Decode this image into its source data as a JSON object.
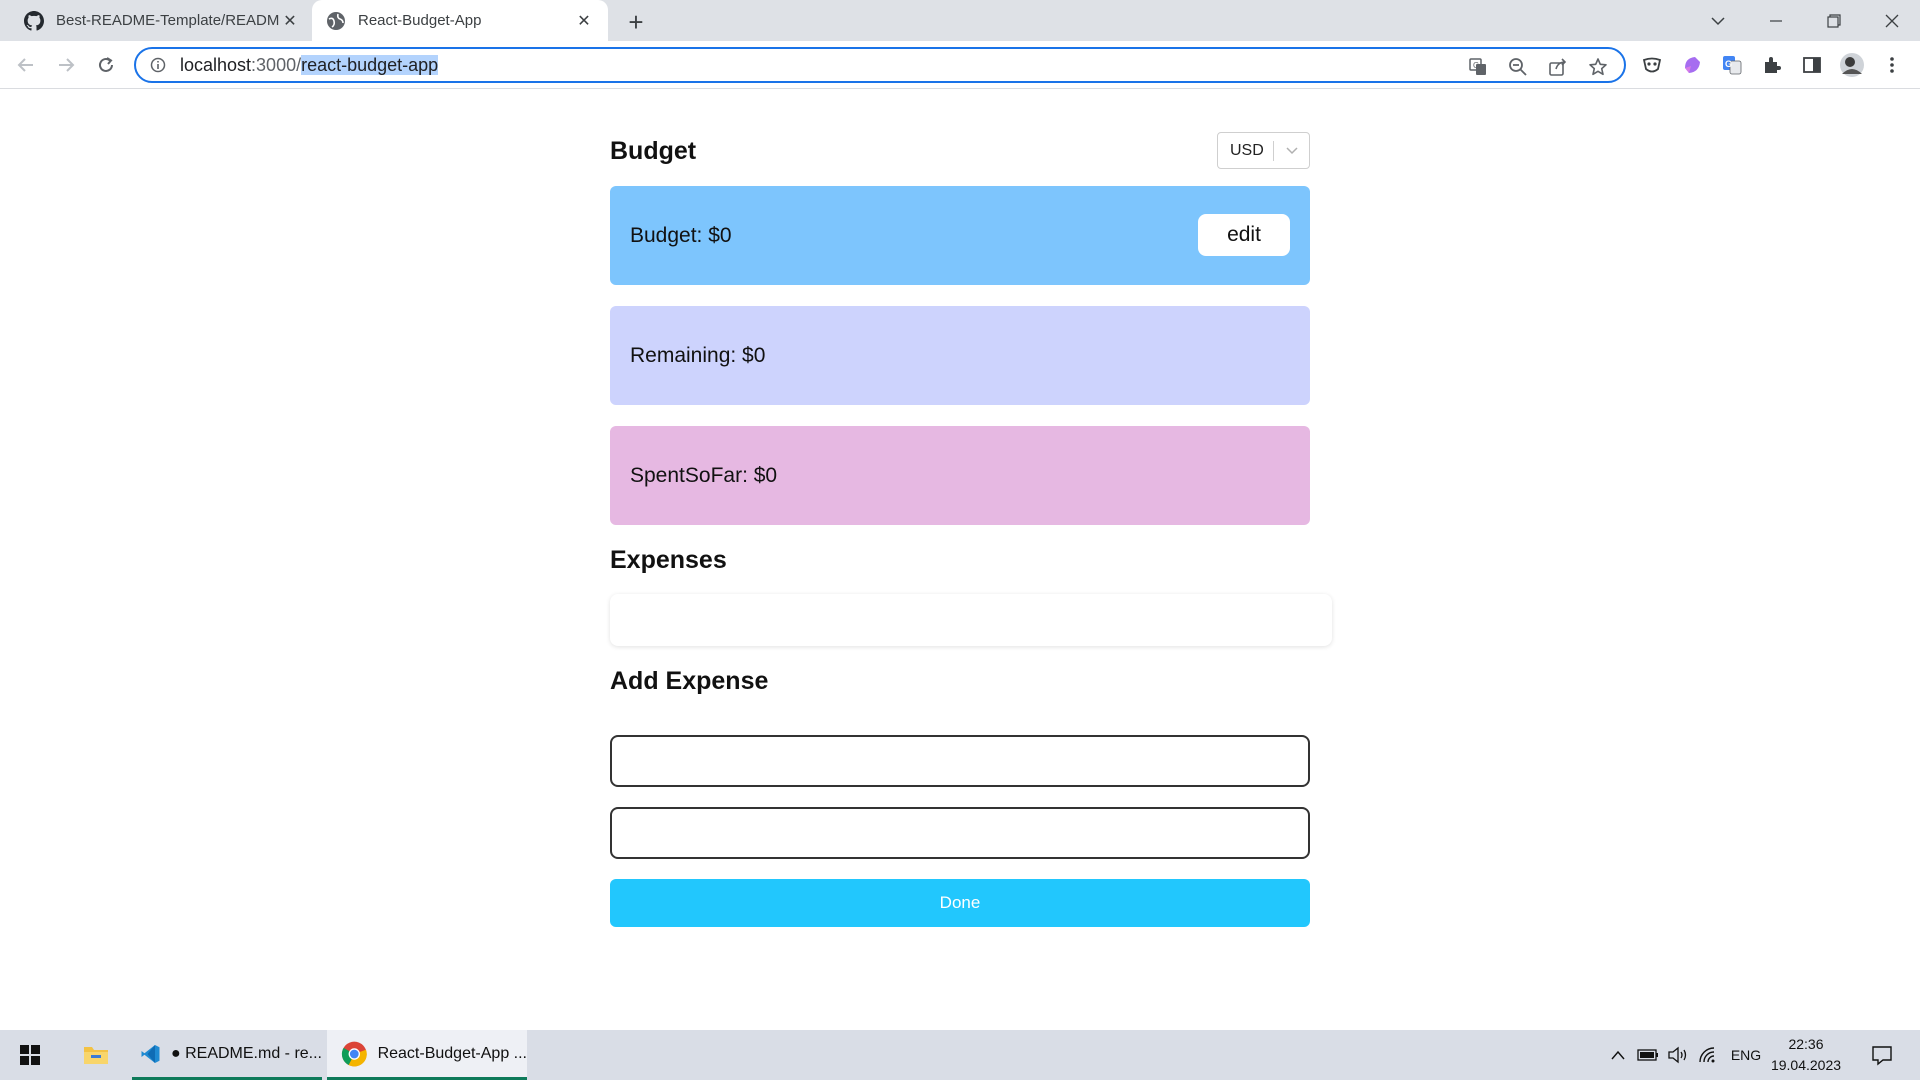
{
  "browser": {
    "tabs": [
      {
        "title": "Best-README-Template/READM",
        "icon": "github-icon",
        "active": false
      },
      {
        "title": "React-Budget-App",
        "icon": "globe-icon",
        "active": true
      }
    ],
    "address": {
      "host": "localhost",
      "port": ":3000/",
      "path": "react-budget-app"
    }
  },
  "app": {
    "budget_heading": "Budget",
    "currency": "USD",
    "budget_card": "Budget: $0",
    "edit_label": "edit",
    "remaining_card": "Remaining: $0",
    "spent_card": "SpentSoFar: $0",
    "expenses_heading": "Expenses",
    "add_expense_heading": "Add Expense",
    "name_input_value": "",
    "cost_input_value": "",
    "done_label": "Done",
    "colors": {
      "budget_card": "#7dc5fd",
      "remaining_card": "#cdd3fd",
      "spent_card": "#e6b8e2",
      "done_button": "#22c7fd"
    }
  },
  "taskbar": {
    "apps": [
      {
        "label": "",
        "icon": "windows-start-icon"
      },
      {
        "label": "",
        "icon": "file-explorer-icon"
      },
      {
        "label": "● README.md - re...",
        "icon": "vscode-icon"
      },
      {
        "label": "React-Budget-App ...",
        "icon": "chrome-icon"
      }
    ],
    "language": "ENG",
    "time": "22:36",
    "date": "19.04.2023"
  }
}
